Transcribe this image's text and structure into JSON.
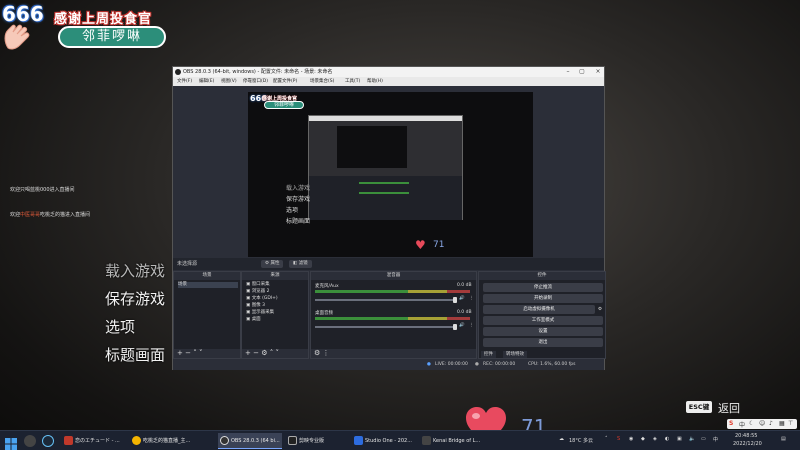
{
  "overlay": {
    "badge": "666",
    "thanks": "感谢上周投食官",
    "name": "邻菲啰啉"
  },
  "chat": [
    {
      "prefix": "欢迎只喝蓝桃000进入直播间",
      "highlight": "",
      "suffix": ""
    },
    {
      "prefix": "欢迎",
      "highlight": "中医哥哥",
      "suffix": "吃桃乏的猫进入直播间"
    }
  ],
  "game_menu": [
    "载入游戏",
    "保存游戏",
    "选项",
    "标题画面"
  ],
  "obs": {
    "title": "OBS 28.0.3 (64-bit, windows) - 配置文件: 未命名 - 场景: 未命名",
    "menu": [
      "文件(F)",
      "编辑(E)",
      "视图(V)",
      "停靠窗口(D)",
      "配置文件(P)",
      "场景集合(S)",
      "工具(T)",
      "帮助(H)"
    ],
    "no_source": "未选择源",
    "props_btn": "属性",
    "filters_btn": "滤镜",
    "docks": {
      "scenes": "场景",
      "sources": "来源",
      "mixer": "混音器",
      "controls": "控件"
    },
    "scene_items": [
      "场景"
    ],
    "source_items": [
      "窗口采集",
      "浏览器 2",
      "文本 (GDI+)",
      "图像 3",
      "显示器采集",
      "桌面"
    ],
    "mixer_channels": [
      {
        "name": "麦克风/Aux",
        "db": "0.0 dB"
      },
      {
        "name": "桌面音频",
        "db": "0.0 dB"
      }
    ],
    "controls_buttons": [
      "停止推流",
      "开始录制",
      "启动虚拟摄像机",
      "工作室模式",
      "设置",
      "退出"
    ],
    "controls_tabs": [
      "控件",
      "转场特效"
    ],
    "status": {
      "live": "LIVE: 00:00:00",
      "rec": "REC: 00:00:00",
      "cpu": "CPU: 1.6%, 60.00 fps"
    },
    "preview": {
      "badge": "666",
      "thanks": "感谢上周投食官",
      "name": "邻菲啰啉",
      "menu": [
        "载入游戏",
        "保存游戏",
        "选项",
        "标题画面"
      ],
      "count": "71"
    }
  },
  "likes": {
    "count": "71"
  },
  "esc": {
    "key": "ESC键",
    "label": "返回"
  },
  "taskbar": {
    "items": [
      {
        "label": "恋のエチュード - ...",
        "color": "#c0392b"
      },
      {
        "label": "吃桃乏的猫直播_主...",
        "color": "#f4b400"
      },
      {
        "label": "OBS 28.0.3 (64 bi...",
        "color": "#333333"
      },
      {
        "label": "剪映专业版",
        "color": "#222222"
      },
      {
        "label": "Studio One - 202...",
        "color": "#2d6cdf"
      },
      {
        "label": "Kenai Bridge of L...",
        "color": "#444444"
      }
    ],
    "weather": "18°C 多云",
    "ime": "中",
    "time": "20:48:55",
    "date": "2022/12/20"
  }
}
